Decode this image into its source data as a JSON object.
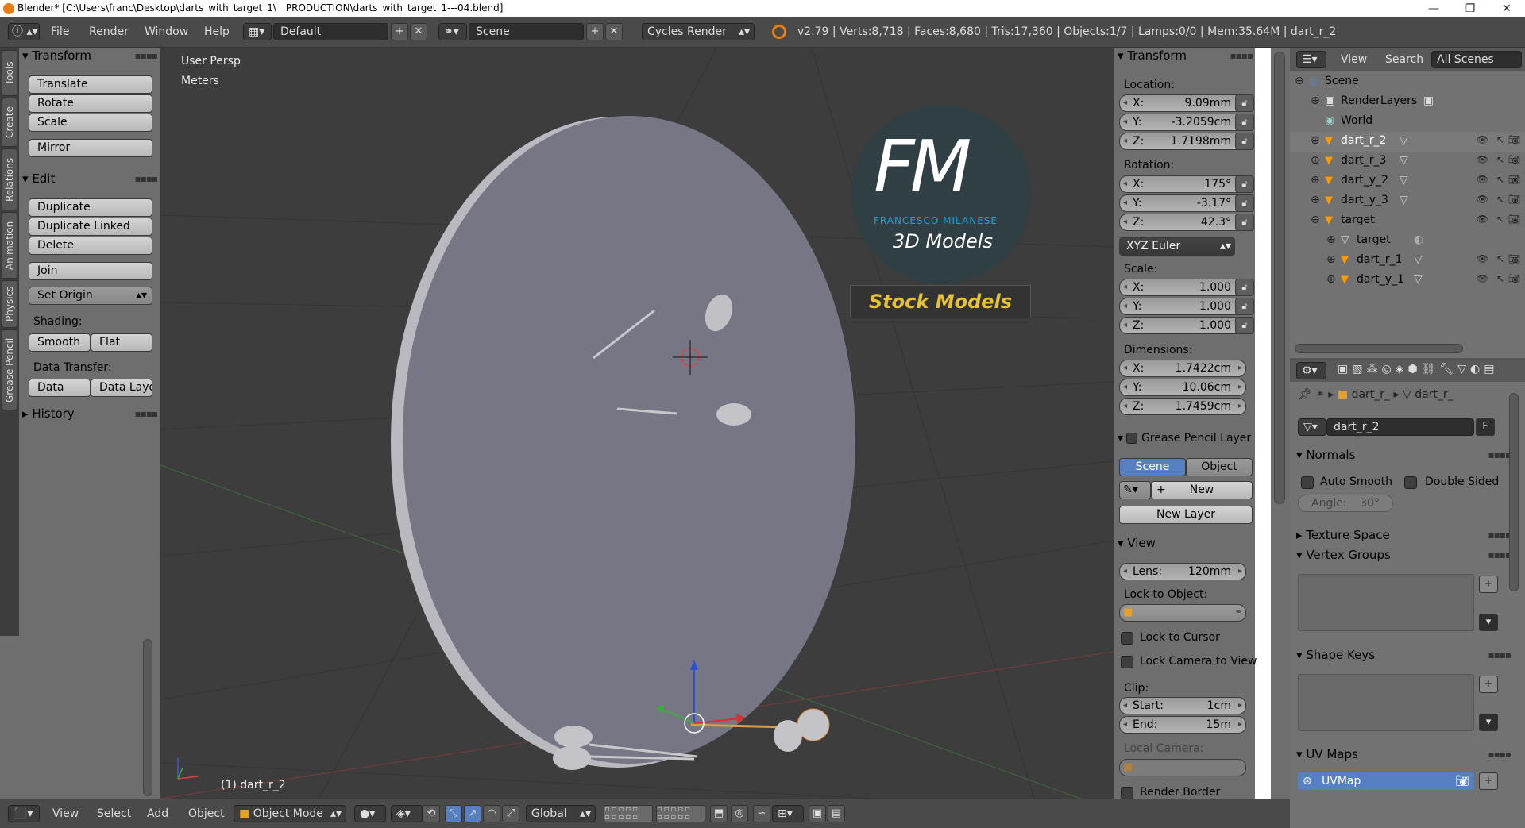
{
  "titlebar": {
    "title": "Blender* [C:\\Users\\franc\\Desktop\\darts_with_target_1\\__PRODUCTION\\darts_with_target_1---04.blend]",
    "minimize": "—",
    "maximize": "❐",
    "close": "✕"
  },
  "menu": {
    "file": "File",
    "render": "Render",
    "window": "Window",
    "help": "Help"
  },
  "screen_layout": "Default",
  "scene_name": "Scene",
  "render_engine": "Cycles Render",
  "stats": "v2.79 | Verts:8,718 | Faces:8,680 | Tris:17,360 | Objects:1/7 | Lamps:0/0 | Mem:35.64M | dart_r_2",
  "vtabs": [
    "Tools",
    "Create",
    "Relations",
    "Animation",
    "Physics",
    "Grease Pencil"
  ],
  "toolshelf": {
    "transform_title": "Transform",
    "translate": "Translate",
    "rotate": "Rotate",
    "scale": "Scale",
    "mirror": "Mirror",
    "edit_title": "Edit",
    "duplicate": "Duplicate",
    "duplicate_linked": "Duplicate Linked",
    "delete": "Delete",
    "join": "Join",
    "set_origin": "Set Origin",
    "shading_label": "Shading:",
    "smooth": "Smooth",
    "flat": "Flat",
    "data_transfer_label": "Data Transfer:",
    "data": "Data",
    "data_layo": "Data Layo",
    "history_title": "History"
  },
  "viewport": {
    "view_name": "User Persp",
    "units": "Meters",
    "active_object": "(1) dart_r_2"
  },
  "watermark": {
    "fm": "FM",
    "brand": "FRANCESCO MILANESE",
    "models": "3D Models",
    "stock": "Stock Models"
  },
  "npanel": {
    "transform_title": "Transform",
    "location_label": "Location:",
    "loc_x": "9.09mm",
    "loc_y": "-3.2059cm",
    "loc_z": "1.7198mm",
    "rotation_label": "Rotation:",
    "rot_x": "175°",
    "rot_y": "-3.17°",
    "rot_z": "42.3°",
    "rotation_mode": "XYZ Euler",
    "scale_label": "Scale:",
    "scl_x": "1.000",
    "scl_y": "1.000",
    "scl_z": "1.000",
    "dimensions_label": "Dimensions:",
    "dim_x": "1.7422cm",
    "dim_y": "10.06cm",
    "dim_z": "1.7459cm",
    "gp_title": "Grease Pencil Layer",
    "gp_scene": "Scene",
    "gp_object": "Object",
    "gp_new": "New",
    "gp_new_layer": "New Layer",
    "view_title": "View",
    "lens_label": "Lens:",
    "lens_value": "120mm",
    "lock_to_object": "Lock to Object:",
    "lock_to_cursor": "Lock to Cursor",
    "lock_camera": "Lock Camera to View",
    "clip_label": "Clip:",
    "clip_start_label": "Start:",
    "clip_start": "1cm",
    "clip_end_label": "End:",
    "clip_end": "15m",
    "local_camera": "Local Camera:",
    "render_border": "Render Border",
    "x": "X:",
    "y": "Y:",
    "z": "Z:"
  },
  "outliner": {
    "view": "View",
    "search": "Search",
    "filter": "All Scenes",
    "rows": [
      {
        "name": "Scene",
        "indent": 0
      },
      {
        "name": "RenderLayers",
        "indent": 1
      },
      {
        "name": "World",
        "indent": 1
      },
      {
        "name": "dart_r_2",
        "indent": 1
      },
      {
        "name": "dart_r_3",
        "indent": 1
      },
      {
        "name": "dart_y_2",
        "indent": 1
      },
      {
        "name": "dart_y_3",
        "indent": 1
      },
      {
        "name": "target",
        "indent": 1
      },
      {
        "name": "target",
        "indent": 2
      },
      {
        "name": "dart_r_1",
        "indent": 2
      },
      {
        "name": "dart_y_1",
        "indent": 2
      }
    ]
  },
  "properties": {
    "breadcrumb_obj": "dart_r_",
    "breadcrumb_mesh": "dart_r_",
    "mesh_name": "dart_r_2",
    "fake_user": "F",
    "normals_title": "Normals",
    "auto_smooth": "Auto Smooth",
    "double_sided": "Double Sided",
    "angle_label": "Angle:",
    "angle_value": "30°",
    "texture_space": "Texture Space",
    "vertex_groups": "Vertex Groups",
    "shape_keys": "Shape Keys",
    "uv_maps": "UV Maps",
    "uvmap_name": "UVMap"
  },
  "bottombar": {
    "view": "View",
    "select": "Select",
    "add": "Add",
    "object": "Object",
    "mode": "Object Mode",
    "orientation": "Global"
  },
  "colors": {
    "accent_blue": "#5680c2",
    "outliner_bg": "#727272",
    "panel_bg": "#6e6e6e",
    "viewport_bg": "#3d3d3d",
    "target": "#767685",
    "fm_blue": "#1aa3dc",
    "stock_yellow": "#e6c230"
  }
}
